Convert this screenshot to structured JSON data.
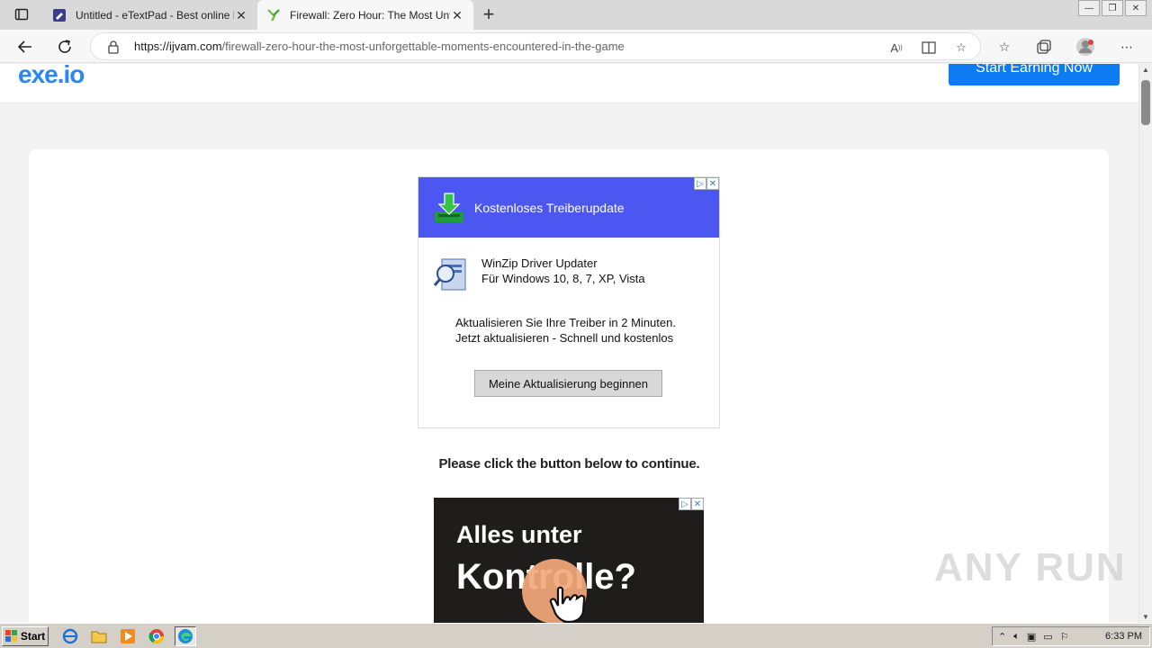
{
  "browser": {
    "tabs": [
      {
        "title": "Untitled - eTextPad - Best online Note",
        "active": false
      },
      {
        "title": "Firewall: Zero Hour: The Most Unforgettable",
        "active": true
      }
    ],
    "url_host": "https://ijvam.com",
    "url_path": "/firewall-zero-hour-the-most-unforgettable-moments-encountered-in-the-game"
  },
  "site": {
    "logo_text": "exe.io",
    "earn_button": "Start Earning Now",
    "continue_text": "Please click the button below to continue."
  },
  "ad1": {
    "header": "Kostenloses Treiberupdate",
    "product_name": "WinZip Driver Updater",
    "product_sub": "Für Windows 10, 8, 7, XP, Vista",
    "desc_line1": "Aktualisieren Sie Ihre Treiber in 2 Minuten.",
    "desc_line2": "Jetzt aktualisieren - Schnell und kostenlos",
    "button": "Meine Aktualisierung beginnen"
  },
  "ad2": {
    "line1": "Alles unter",
    "line2": "Kontrolle?"
  },
  "watermark": "ANY RUN",
  "taskbar": {
    "start_label": "Start",
    "clock": "6:33 PM"
  },
  "colors": {
    "ad1_header": "#4b57f0",
    "earn_button": "#0d7bf2",
    "ad2_bg": "#1f1d1b"
  }
}
